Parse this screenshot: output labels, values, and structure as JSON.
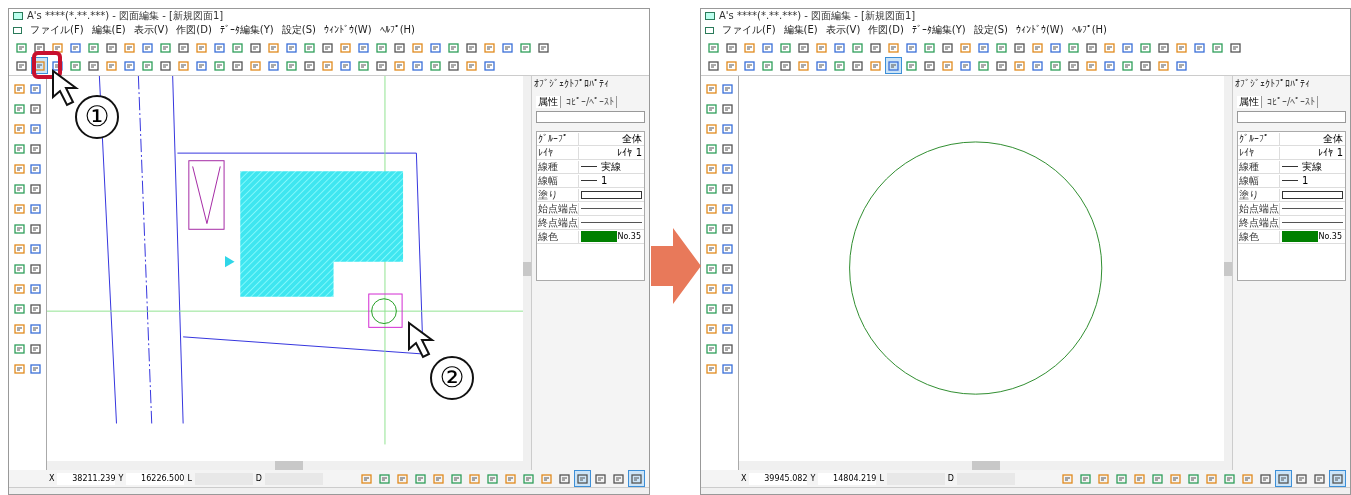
{
  "windows": [
    {
      "title": "A's ****(*.**.***) - 図面編集 - [新規図面1]",
      "kind": "plan",
      "menu": [
        "ファイル(F)",
        "編集(E)",
        "表示(V)",
        "作図(D)",
        "ﾃﾞｰﾀ編集(Y)",
        "設定(S)",
        "ｳｨﾝﾄﾞｳ(W)",
        "ﾍﾙﾌﾟ(H)"
      ],
      "toolbar_row2": [
        {
          "selected": false
        },
        {
          "selected": true
        },
        {
          "selected": false
        },
        {
          "selected": false
        },
        {
          "selected": false
        },
        {
          "selected": false
        },
        {
          "selected": false
        },
        {
          "selected": false
        },
        {
          "selected": false
        },
        {
          "selected": false
        },
        {
          "selected": false
        },
        {
          "selected": false
        },
        {
          "selected": false
        },
        {
          "selected": false
        },
        {
          "selected": false
        },
        {
          "selected": false
        },
        {
          "selected": false
        },
        {
          "selected": false
        },
        {
          "selected": false
        },
        {
          "selected": false
        },
        {
          "selected": false
        },
        {
          "selected": false
        },
        {
          "selected": false
        },
        {
          "selected": false
        },
        {
          "selected": false
        },
        {
          "selected": false
        },
        {
          "selected": false
        }
      ],
      "panel": {
        "title": "ｵﾌﾞｼﾞｪｸﾄﾌﾟﾛﾊﾟﾃｨ",
        "tabs": [
          {
            "label": "属性",
            "selected": true
          },
          {
            "label": "ｺﾋﾟｰ/ﾍﾟｰｽﾄ",
            "selected": false
          }
        ],
        "properties": [
          {
            "kind": "text",
            "label": "ｸﾞﾙｰﾌﾟ",
            "value": "全体"
          },
          {
            "kind": "text",
            "label": "ﾚｲﾔ",
            "value": "ﾚｲﾔ 1"
          },
          {
            "kind": "line",
            "label": "線種",
            "value": "実線"
          },
          {
            "kind": "line",
            "label": "線幅",
            "value": "1"
          },
          {
            "kind": "fill",
            "label": "塗り"
          },
          {
            "kind": "rule",
            "label": "始点端点"
          },
          {
            "kind": "rule",
            "label": "終点端点"
          },
          {
            "kind": "color",
            "label": "線色",
            "value": "No.35",
            "color": "#008000"
          }
        ]
      },
      "coords": [
        {
          "label": "X",
          "value": "38211.239"
        },
        {
          "label": "Y",
          "value": "16226.500"
        },
        {
          "label": "L"
        },
        {
          "label": "D"
        }
      ],
      "view_buttons": [
        {
          "selected": false
        },
        {
          "selected": true
        },
        {
          "selected": false
        },
        {
          "selected": false
        },
        {
          "selected": true
        }
      ],
      "callouts": [
        "①",
        "②"
      ]
    },
    {
      "title": "A's ****(*.**.***) - 図面編集 - [新規図面1]",
      "kind": "circle",
      "menu": [
        "ファイル(F)",
        "編集(E)",
        "表示(V)",
        "作図(D)",
        "ﾃﾞｰﾀ編集(Y)",
        "設定(S)",
        "ｳｨﾝﾄﾞｳ(W)",
        "ﾍﾙﾌﾟ(H)"
      ],
      "toolbar_row2": [
        {
          "selected": false
        },
        {
          "selected": false
        },
        {
          "selected": false
        },
        {
          "selected": false
        },
        {
          "selected": false
        },
        {
          "selected": false
        },
        {
          "selected": false
        },
        {
          "selected": false
        },
        {
          "selected": false
        },
        {
          "selected": false
        },
        {
          "selected": true
        },
        {
          "selected": false
        },
        {
          "selected": false
        },
        {
          "selected": false
        },
        {
          "selected": false
        },
        {
          "selected": false
        },
        {
          "selected": false
        },
        {
          "selected": false
        },
        {
          "selected": false
        },
        {
          "selected": false
        },
        {
          "selected": false
        },
        {
          "selected": false
        },
        {
          "selected": false
        },
        {
          "selected": false
        },
        {
          "selected": false
        },
        {
          "selected": false
        },
        {
          "selected": false
        }
      ],
      "panel": {
        "title": "ｵﾌﾞｼﾞｪｸﾄﾌﾟﾛﾊﾟﾃｨ",
        "tabs": [
          {
            "label": "属性",
            "selected": true
          },
          {
            "label": "ｺﾋﾟｰ/ﾍﾟｰｽﾄ",
            "selected": false
          }
        ],
        "properties": [
          {
            "kind": "text",
            "label": "ｸﾞﾙｰﾌﾟ",
            "value": "全体"
          },
          {
            "kind": "text",
            "label": "ﾚｲﾔ",
            "value": "ﾚｲﾔ 1"
          },
          {
            "kind": "line",
            "label": "線種",
            "value": "実線"
          },
          {
            "kind": "line",
            "label": "線幅",
            "value": "1"
          },
          {
            "kind": "fill",
            "label": "塗り"
          },
          {
            "kind": "rule",
            "label": "始点端点"
          },
          {
            "kind": "rule",
            "label": "終点端点"
          },
          {
            "kind": "color",
            "label": "線色",
            "value": "No.35",
            "color": "#008000"
          }
        ]
      },
      "coords": [
        {
          "label": "X",
          "value": "39945.082"
        },
        {
          "label": "Y",
          "value": "14804.219"
        },
        {
          "label": "L"
        },
        {
          "label": "D"
        }
      ],
      "view_buttons": [
        {
          "selected": false
        },
        {
          "selected": true
        },
        {
          "selected": false
        },
        {
          "selected": false
        },
        {
          "selected": true
        }
      ]
    }
  ]
}
